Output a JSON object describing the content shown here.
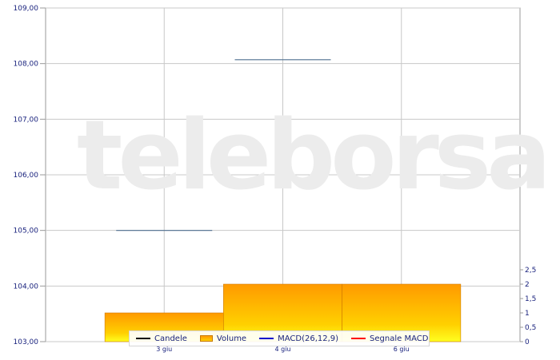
{
  "watermark": "teleborsa",
  "chart_data": {
    "type": "candlestick",
    "categories": [
      "3 giu",
      "4 giu",
      "6 giu"
    ],
    "price": {
      "ylim": [
        103,
        109
      ],
      "ticks": [
        "109,00",
        "108,00",
        "107,00",
        "106,00",
        "105,00",
        "104,00",
        "103,00"
      ],
      "candles": [
        {
          "x": "3 giu",
          "open": 105.0,
          "close": 105.0
        },
        {
          "x": "4 giu",
          "open": 108.07,
          "close": 108.07
        }
      ]
    },
    "volume": {
      "ylim": [
        0,
        2.5
      ],
      "ticks": [
        "2,5",
        "2",
        "1,5",
        "1",
        "0,5",
        "0"
      ],
      "values": [
        1,
        2,
        2
      ]
    },
    "legend": [
      {
        "label": "Candele",
        "color": "#000000",
        "kind": "line"
      },
      {
        "label": "Volume",
        "color": "#ffb000",
        "kind": "box"
      },
      {
        "label": "MACD(26,12,9)",
        "color": "#0000cc",
        "kind": "line"
      },
      {
        "label": "Segnale MACD",
        "color": "#ff0000",
        "kind": "line"
      }
    ],
    "grid": true
  }
}
